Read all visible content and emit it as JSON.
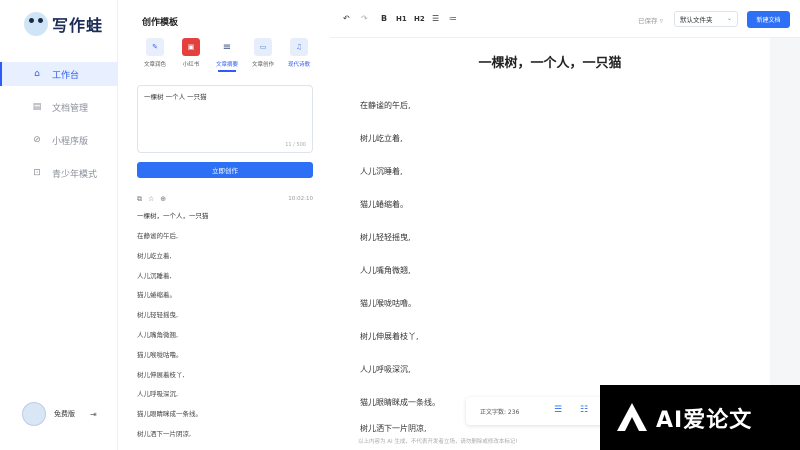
{
  "app": {
    "name": "写作蛙"
  },
  "sidebar": {
    "items": [
      {
        "label": "工作台",
        "icon": "home-icon",
        "active": true
      },
      {
        "label": "文档管理",
        "icon": "document-icon",
        "active": false
      },
      {
        "label": "小程序版",
        "icon": "miniprogram-icon",
        "active": false
      },
      {
        "label": "青少年模式",
        "icon": "teen-mode-icon",
        "active": false
      }
    ],
    "user": {
      "name": "免费版"
    }
  },
  "templates": {
    "title": "创作模板",
    "tabs": [
      {
        "label": "文章润色",
        "icon": "brush-icon",
        "color": "#3a6ae8",
        "active": false
      },
      {
        "label": "小红书",
        "icon": "xiaohongshu-icon",
        "color": "#e34040",
        "active": false
      },
      {
        "label": "文章摘要",
        "icon": "summary-icon",
        "color": "#2f4a7a",
        "active": true
      },
      {
        "label": "文章创作",
        "icon": "create-icon",
        "color": "#4f7fd8",
        "active": false
      },
      {
        "label": "现代诗歌",
        "icon": "poetry-icon",
        "color": "#5b86e5",
        "active": false
      }
    ],
    "input_value": "一棵树 一个人 一只猫",
    "char_count": "11 / 500",
    "create_label": "立即创作",
    "result": {
      "time": "10:02:10",
      "title": "一棵树，一个人，一只猫",
      "lines": [
        "在静谧的午后,",
        "树儿屹立着,",
        "人儿沉睡着,",
        "猫儿蜷缩着。",
        "树儿轻轻摇曳,",
        "人儿嘴角微翘,",
        "猫儿喉咙咕噜。",
        "树儿伸展着枝丫,",
        "人儿呼吸深沉,",
        "猫儿眼睛眯成一条线。",
        "树儿洒下一片阴凉,"
      ]
    }
  },
  "toolbar": {
    "undo": "↶",
    "redo": "↷",
    "bold": "B",
    "h1": "H1",
    "h2": "H2",
    "saved": "已保存",
    "folder": "默认文件夹",
    "new_doc": "新建文档"
  },
  "document": {
    "title": "一棵树，一个人，一只猫",
    "lines": [
      "在静谧的午后,",
      "树儿屹立着,",
      "人儿沉睡着,",
      "猫儿蜷缩着。",
      "树儿轻轻摇曳,",
      "人儿嘴角微翘,",
      "猫儿喉咙咕噜。",
      "树儿伸展着枝丫,",
      "人儿呼吸深沉,",
      "猫儿眼睛眯成一条线。",
      "树儿洒下一片阴凉,"
    ],
    "word_count": "正文字数: 236",
    "disclaimer": "以上内容为 AI 生成，不代表开发者立场，请勿删除或修改本标记!"
  },
  "watermark": {
    "text": "AI爱论文"
  }
}
